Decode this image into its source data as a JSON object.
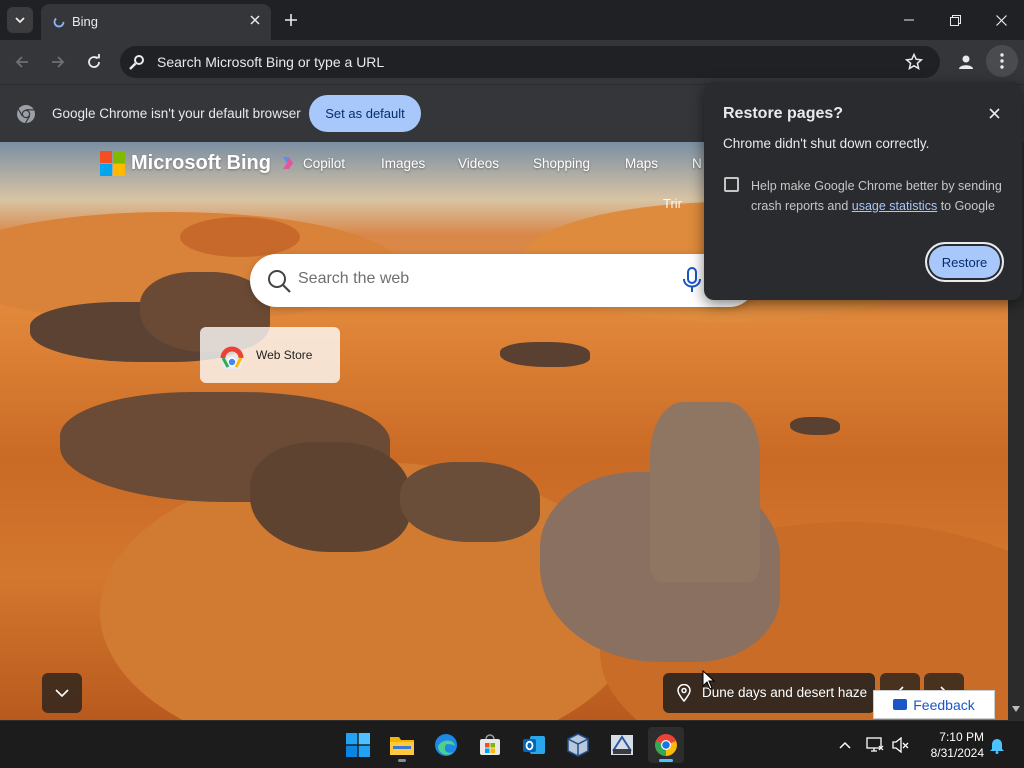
{
  "browser": {
    "tab": {
      "title": "Bing"
    },
    "omnibox": {
      "placeholder": "Search Microsoft Bing or type a URL"
    }
  },
  "infobar": {
    "message": "Google Chrome isn't your default browser",
    "button_label": "Set as default"
  },
  "bing": {
    "logo_text": "Microsoft Bing",
    "nav": [
      "Copilot",
      "Images",
      "Videos",
      "Shopping",
      "Maps",
      "N"
    ],
    "trending_text": "Trir",
    "search_placeholder": "Search the web",
    "tile_label": "Web Store",
    "caption": "Dune days and desert haze",
    "feedback_label": "Feedback"
  },
  "restore_dialog": {
    "title": "Restore pages?",
    "message": "Chrome didn't shut down correctly.",
    "checkbox_text_before": "Help make Google Chrome better by sending crash reports and ",
    "checkbox_link": "usage statistics",
    "checkbox_text_after": " to Google",
    "checkbox_checked": false,
    "button_label": "Restore"
  },
  "taskbar": {
    "apps": [
      "start-icon",
      "file-explorer-icon",
      "edge-icon",
      "store-icon",
      "outlook-icon",
      "virtualbox-icon",
      "sql-server-icon",
      "chrome-icon"
    ],
    "active_app": "chrome-icon",
    "clock_time": "7:10 PM",
    "clock_date": "8/31/2024"
  },
  "colors": {
    "accent": "#a8c7fa",
    "dialog_bg": "#2a2b2e",
    "toolbar_bg": "#35363a",
    "taskbar_active": "#4cc2ff"
  }
}
